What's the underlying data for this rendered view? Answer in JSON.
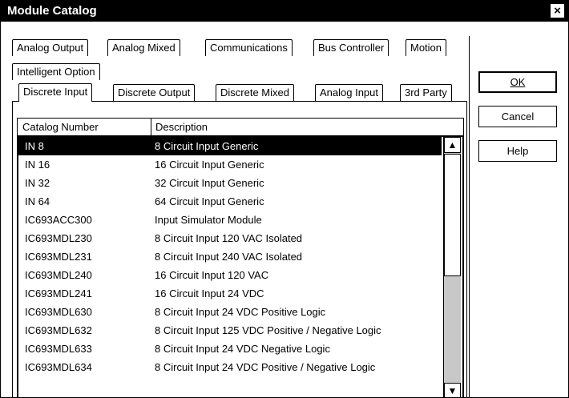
{
  "window": {
    "title": "Module Catalog",
    "close": "×"
  },
  "tabs": {
    "row1": [
      "Analog Output",
      "Analog Mixed",
      "Communications",
      "Bus Controller",
      "Motion"
    ],
    "row2": [
      "Intelligent Option"
    ],
    "row3": [
      "Discrete Input",
      "Discrete Output",
      "Discrete Mixed",
      "Analog Input",
      "3rd Party"
    ],
    "active": "Discrete Input"
  },
  "buttons": {
    "ok": "OK",
    "cancel": "Cancel",
    "help": "Help"
  },
  "list": {
    "columns": [
      "Catalog Number",
      "Description"
    ],
    "selected_index": 0,
    "rows": [
      [
        "IN 8",
        "8 Circuit Input Generic"
      ],
      [
        "IN 16",
        "16 Circuit Input Generic"
      ],
      [
        "IN 32",
        "32 Circuit Input Generic"
      ],
      [
        "IN 64",
        "64 Circuit Input Generic"
      ],
      [
        "IC693ACC300",
        "Input Simulator Module"
      ],
      [
        "IC693MDL230",
        "8 Circuit Input 120 VAC Isolated"
      ],
      [
        "IC693MDL231",
        "8 Circuit Input 240 VAC Isolated"
      ],
      [
        "IC693MDL240",
        "16 Circuit Input 120 VAC"
      ],
      [
        "IC693MDL241",
        "16 Circuit Input 24 VDC"
      ],
      [
        "IC693MDL630",
        "8 Circuit Input 24 VDC Positive Logic"
      ],
      [
        "IC693MDL632",
        "8 Circuit Input 125 VDC Positive / Negative Logic"
      ],
      [
        "IC693MDL633",
        "8 Circuit Input 24 VDC Negative Logic"
      ],
      [
        "IC693MDL634",
        "8 Circuit Input 24 VDC Positive / Negative Logic"
      ]
    ]
  }
}
